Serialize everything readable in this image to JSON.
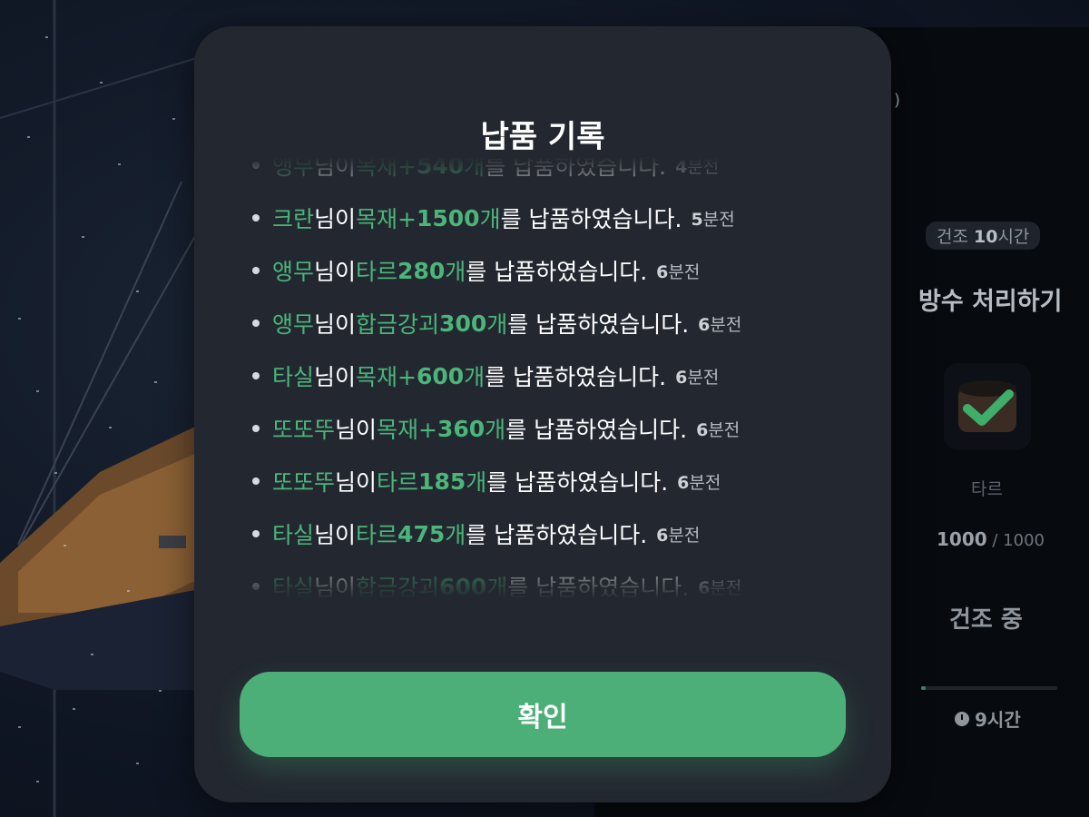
{
  "modal": {
    "title": "납품 기록",
    "confirm_label": "확인",
    "entries": [
      {
        "name": "앵무",
        "mid1": "님이 ",
        "item": "목재+",
        "qty": "540",
        "unit": "개",
        "tail": "를 납품하였습니다.",
        "time_num": "4",
        "time_unit": "분전"
      },
      {
        "name": "크란",
        "mid1": "님이 ",
        "item": "목재+",
        "qty": "1500",
        "unit": "개",
        "tail": "를 납품하였습니다.",
        "time_num": "5",
        "time_unit": "분전"
      },
      {
        "name": "앵무",
        "mid1": "님이 ",
        "item": "타르",
        "qty": "280",
        "unit": "개",
        "tail": "를 납품하였습니다.",
        "time_num": "6",
        "time_unit": "분전"
      },
      {
        "name": "앵무",
        "mid1": "님이 ",
        "item": "합금강괴",
        "qty": "300",
        "unit": "개",
        "tail": "를 납품하였습니다.",
        "time_num": "6",
        "time_unit": "분전"
      },
      {
        "name": "타실",
        "mid1": "님이 ",
        "item": "목재+",
        "qty": "600",
        "unit": "개",
        "tail": "를 납품하였습니다.",
        "time_num": "6",
        "time_unit": "분전"
      },
      {
        "name": "또또뚜",
        "mid1": "님이 ",
        "item": "목재+",
        "qty": "360",
        "unit": "개",
        "tail": "를 납품하였습니다.",
        "time_num": "6",
        "time_unit": "분전"
      },
      {
        "name": "또또뚜",
        "mid1": "님이 ",
        "item": "타르",
        "qty": "185",
        "unit": "개",
        "tail": "를 납품하였습니다.",
        "time_num": "6",
        "time_unit": "분전"
      },
      {
        "name": "타실",
        "mid1": "님이 ",
        "item": "타르",
        "qty": "475",
        "unit": "개",
        "tail": "를 납품하였습니다.",
        "time_num": "6",
        "time_unit": "분전"
      },
      {
        "name": "타실",
        "mid1": "님이 ",
        "item": "합금강괴",
        "qty": "600",
        "unit": "개",
        "tail": "를 납품하였습니다.",
        "time_num": "6",
        "time_unit": "분전"
      }
    ]
  },
  "side_panel": {
    "top_label": ")",
    "badge_prefix": "건조 ",
    "badge_value": "10",
    "badge_unit": "시간",
    "title": "방수 처리하기",
    "item_name": "타르",
    "count_current": "1000",
    "count_total": " / 1000",
    "status": "건조 중",
    "progress_fraction": 0.03,
    "timer": "9시간"
  },
  "colors": {
    "accent_green": "#4caf78",
    "modal_bg": "#232830",
    "highlight_text": "#4bb57a"
  }
}
